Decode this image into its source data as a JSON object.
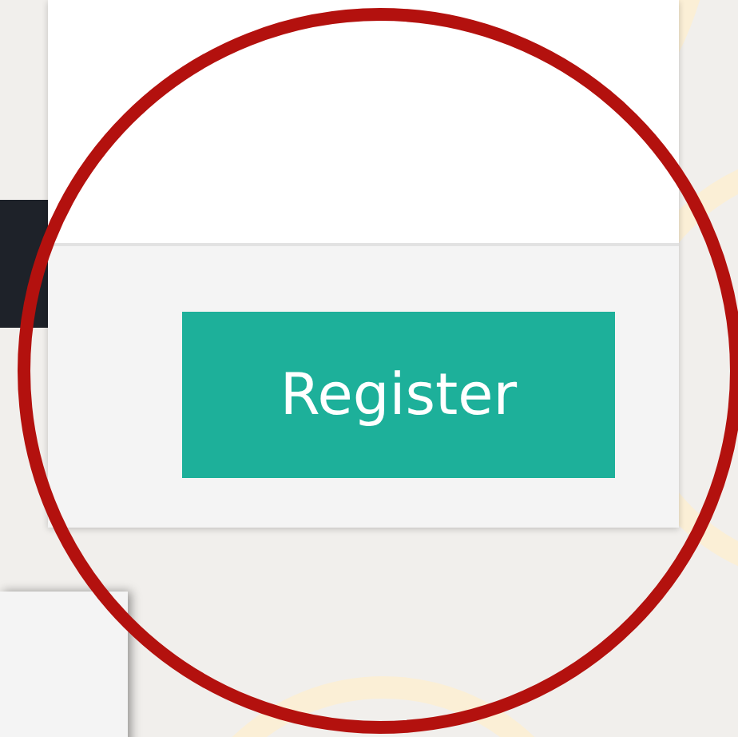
{
  "form_footer": {
    "button": {
      "label": "Register"
    }
  }
}
